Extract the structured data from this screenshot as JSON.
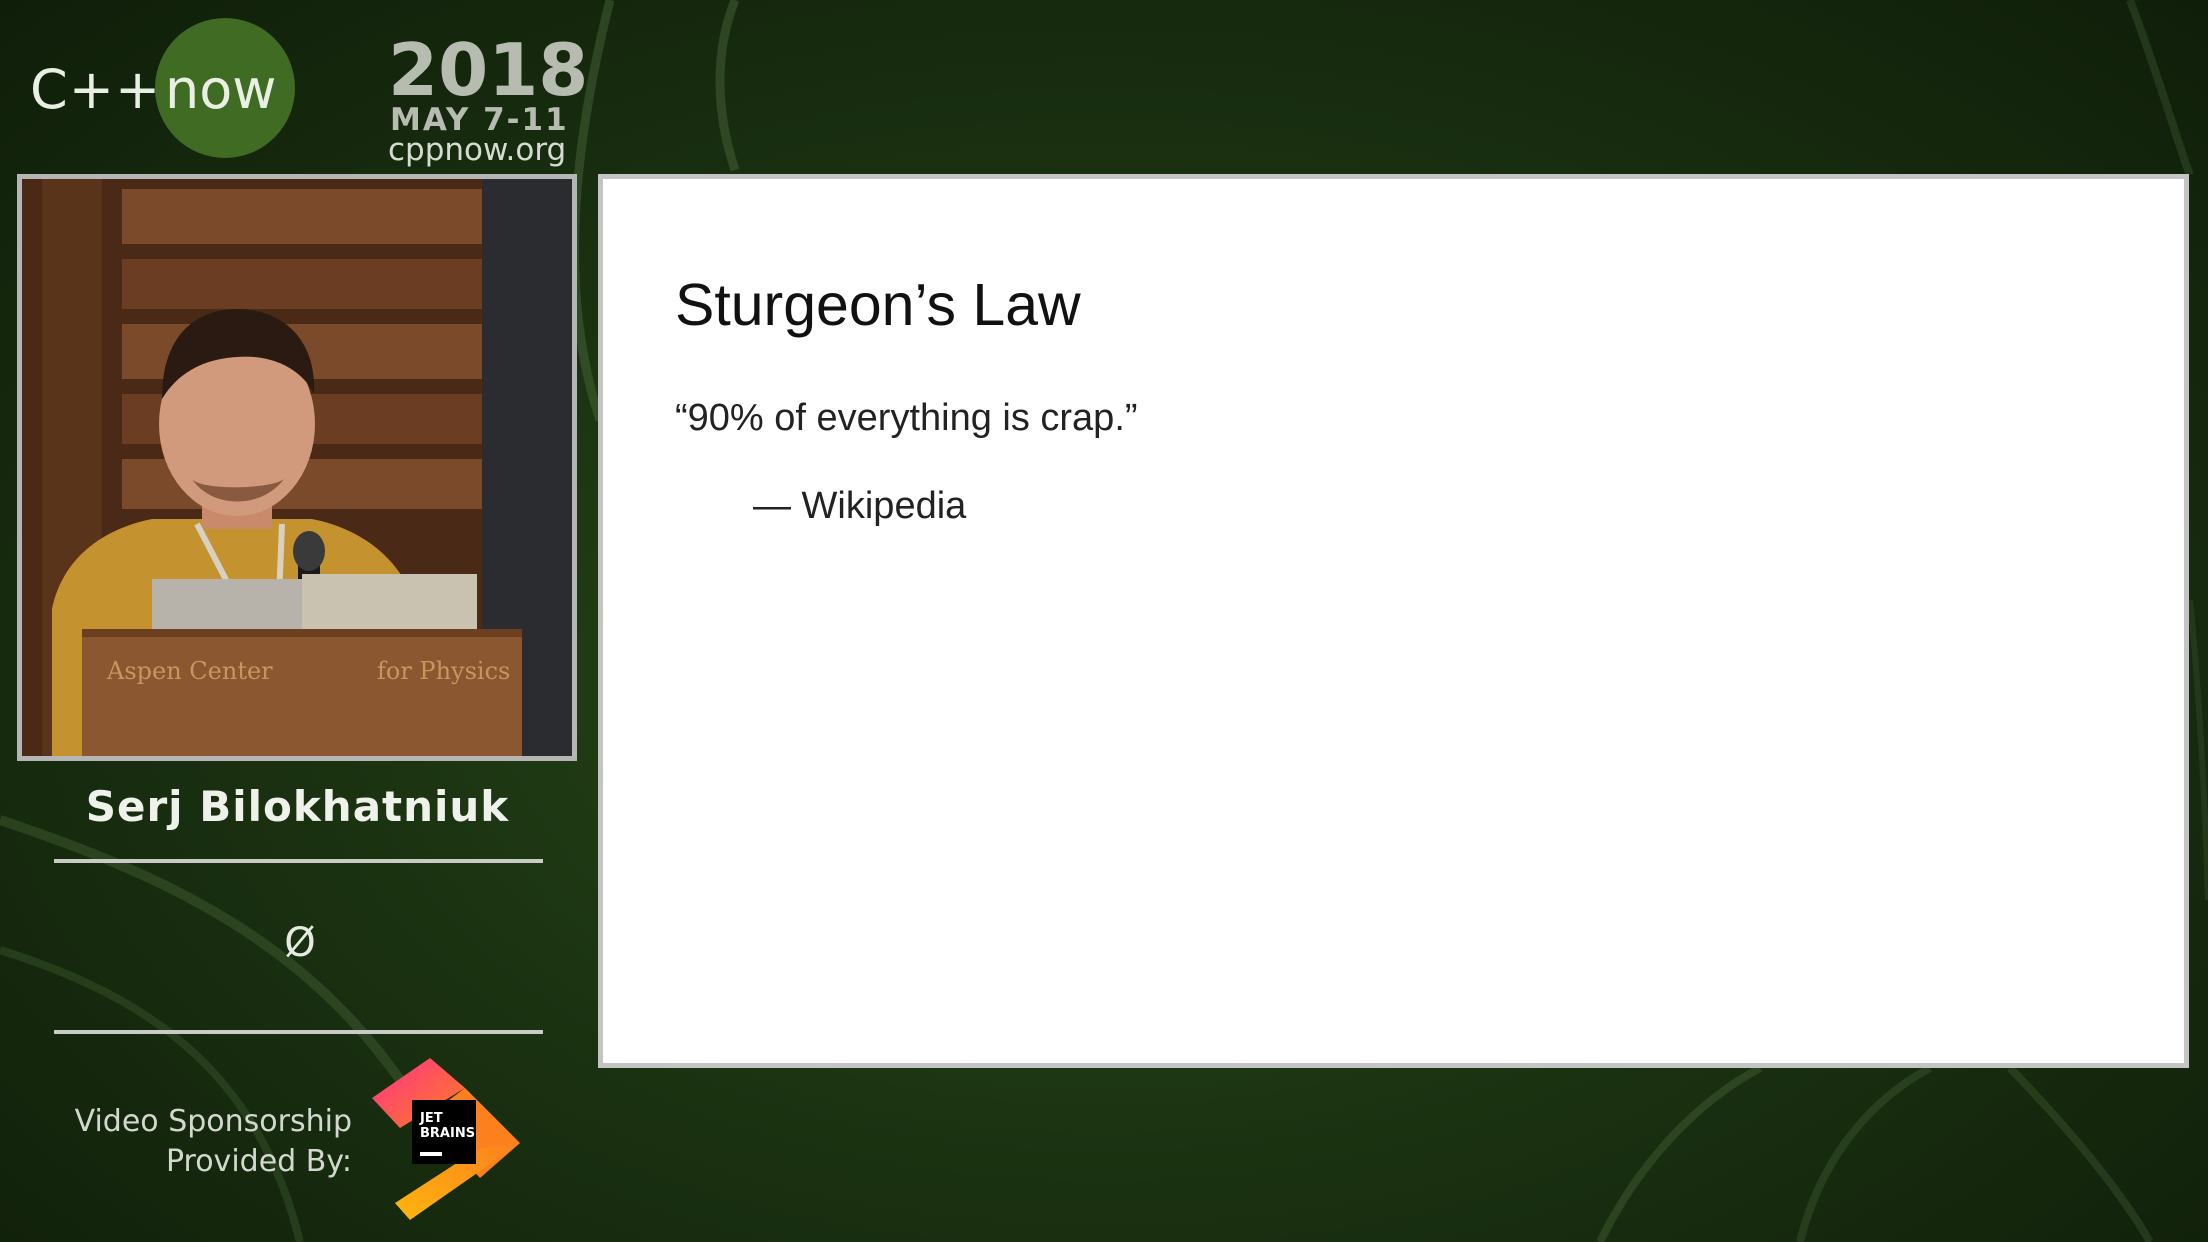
{
  "header": {
    "logo_prefix": "C++",
    "logo_suffix": "now",
    "year": "2018",
    "dates": "MAY 7-11",
    "website": "cppnow.org"
  },
  "speaker": {
    "name": "Serj Bilokhatniuk",
    "affiliation": "Ø"
  },
  "sponsor": {
    "line1": "Video Sponsorship",
    "line2": "Provided By:",
    "logo_text_line1": "JET",
    "logo_text_line2": "BRAINS"
  },
  "slide": {
    "title": "Sturgeon’s Law",
    "quote": "“90% of everything is crap.”",
    "attribution": "— Wikipedia"
  },
  "video": {
    "podium_text_left": "Aspen Center",
    "podium_text_right": "for Physics"
  },
  "colors": {
    "background": "#1c3412",
    "logo_circle": "#3f6b23",
    "slide_background": "#ffffff"
  }
}
